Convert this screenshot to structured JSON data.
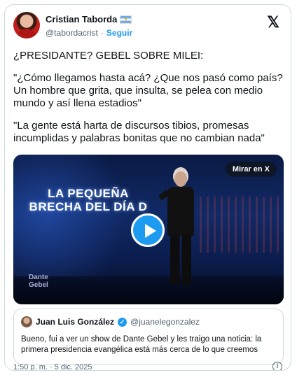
{
  "author": {
    "name": "Cristian Taborda",
    "handle": "@tabordacrist",
    "separator": "·",
    "follow_label": "Seguir",
    "flag_icon": "argentina-flag-icon"
  },
  "x_logo": "𝕏",
  "tweet": {
    "paragraphs": [
      "¿PRESIDANTE? GEBEL SOBRE MILEI:",
      "\"¿Cómo llegamos hasta acá? ¿Que nos pasó como país? Un hombre que grita, que insulta, se pelea con medio mundo y así llena estadios\"",
      "\"La gente está harta de discursos tibios, promesas incumplidas y palabras bonitas que no cambian nada\""
    ]
  },
  "media": {
    "watch_label": "Mirar en X",
    "overlay_title": "LA PEQUEÑA BRECHA DEL DÍA D",
    "brand": "Dante\nGebel"
  },
  "quote": {
    "name": "Juan Luis González",
    "handle": "@juanelegonzalez",
    "text": "Bueno, fui a ver un show de Dante Gebel y les traigo una noticia: la primera presidencia evangélica está más cerca de lo que creemos"
  },
  "footer": {
    "timestamp": "1:50 p. m. · 5 dic. 2025",
    "info_icon": "info-icon"
  },
  "colors": {
    "accent": "#1d9bf0",
    "text": "#0f1419",
    "muted": "#536471",
    "border": "#cfd9de"
  }
}
